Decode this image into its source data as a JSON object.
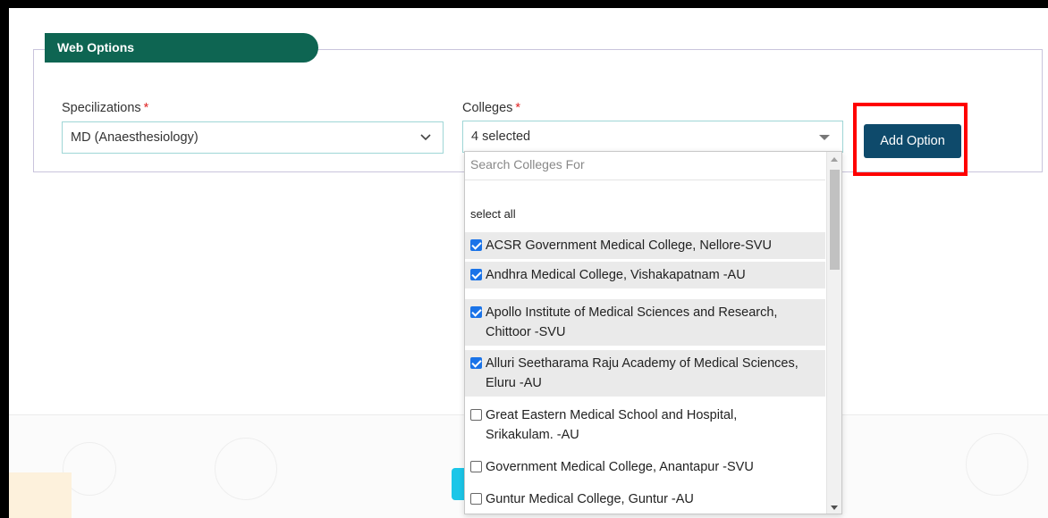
{
  "section": {
    "title": "Web Options"
  },
  "specializations": {
    "label": "Specilizations",
    "required_mark": "*",
    "selected": "MD (Anaesthesiology)"
  },
  "colleges": {
    "label": "Colleges",
    "required_mark": "*",
    "selected_text": "4 selected",
    "search_placeholder": "Search Colleges For",
    "select_all": "select all",
    "options": [
      {
        "line1": "ACSR Government Medical College, Nellore-SVU",
        "line2": "",
        "checked": true
      },
      {
        "line1": "Andhra Medical College, Vishakapatnam -AU",
        "line2": "",
        "checked": true
      },
      {
        "line1": "Apollo Institute of Medical Sciences and Research,",
        "line2": "Chittoor -SVU",
        "checked": true
      },
      {
        "line1": "Alluri Seetharama Raju Academy of Medical Sciences,",
        "line2": "Eluru -AU",
        "checked": true
      },
      {
        "line1": "Great Eastern Medical School and Hospital,",
        "line2": "Srikakulam. -AU",
        "checked": false
      },
      {
        "line1": "Government Medical College, Anantapur -SVU",
        "line2": "",
        "checked": false
      },
      {
        "line1": "Guntur Medical College, Guntur -AU",
        "line2": "",
        "checked": false
      }
    ]
  },
  "actions": {
    "add_option": "Add Option"
  },
  "colors": {
    "legend_bg": "#0e6552",
    "button_bg": "#0e4a6b",
    "highlight": "#ff0000",
    "checkbox": "#1a73e8"
  }
}
